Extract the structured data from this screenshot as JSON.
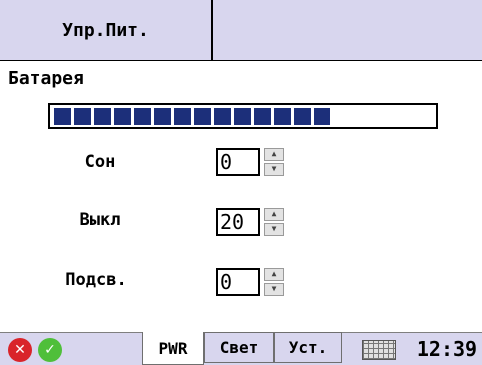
{
  "header": {
    "tab_label": "Упр.Пит."
  },
  "battery": {
    "label": "Батарея",
    "level_fraction": 0.73
  },
  "fields": [
    {
      "label": "Сон",
      "value": "0"
    },
    {
      "label": "Выкл",
      "value": "20"
    },
    {
      "label": "Подсв.",
      "value": "0"
    }
  ],
  "taskbar": {
    "tabs": [
      {
        "label": "PWR",
        "active": true
      },
      {
        "label": "Свет",
        "active": false
      },
      {
        "label": "Уст.",
        "active": false
      }
    ],
    "clock": "12:39",
    "icons": [
      "close-icon",
      "ok-icon",
      "keyboard-icon"
    ]
  },
  "colors": {
    "chrome": "#d8d6ee",
    "battery_fill": "#1c2f7a",
    "cancel": "#d9242a",
    "ok": "#4fbf3a"
  }
}
